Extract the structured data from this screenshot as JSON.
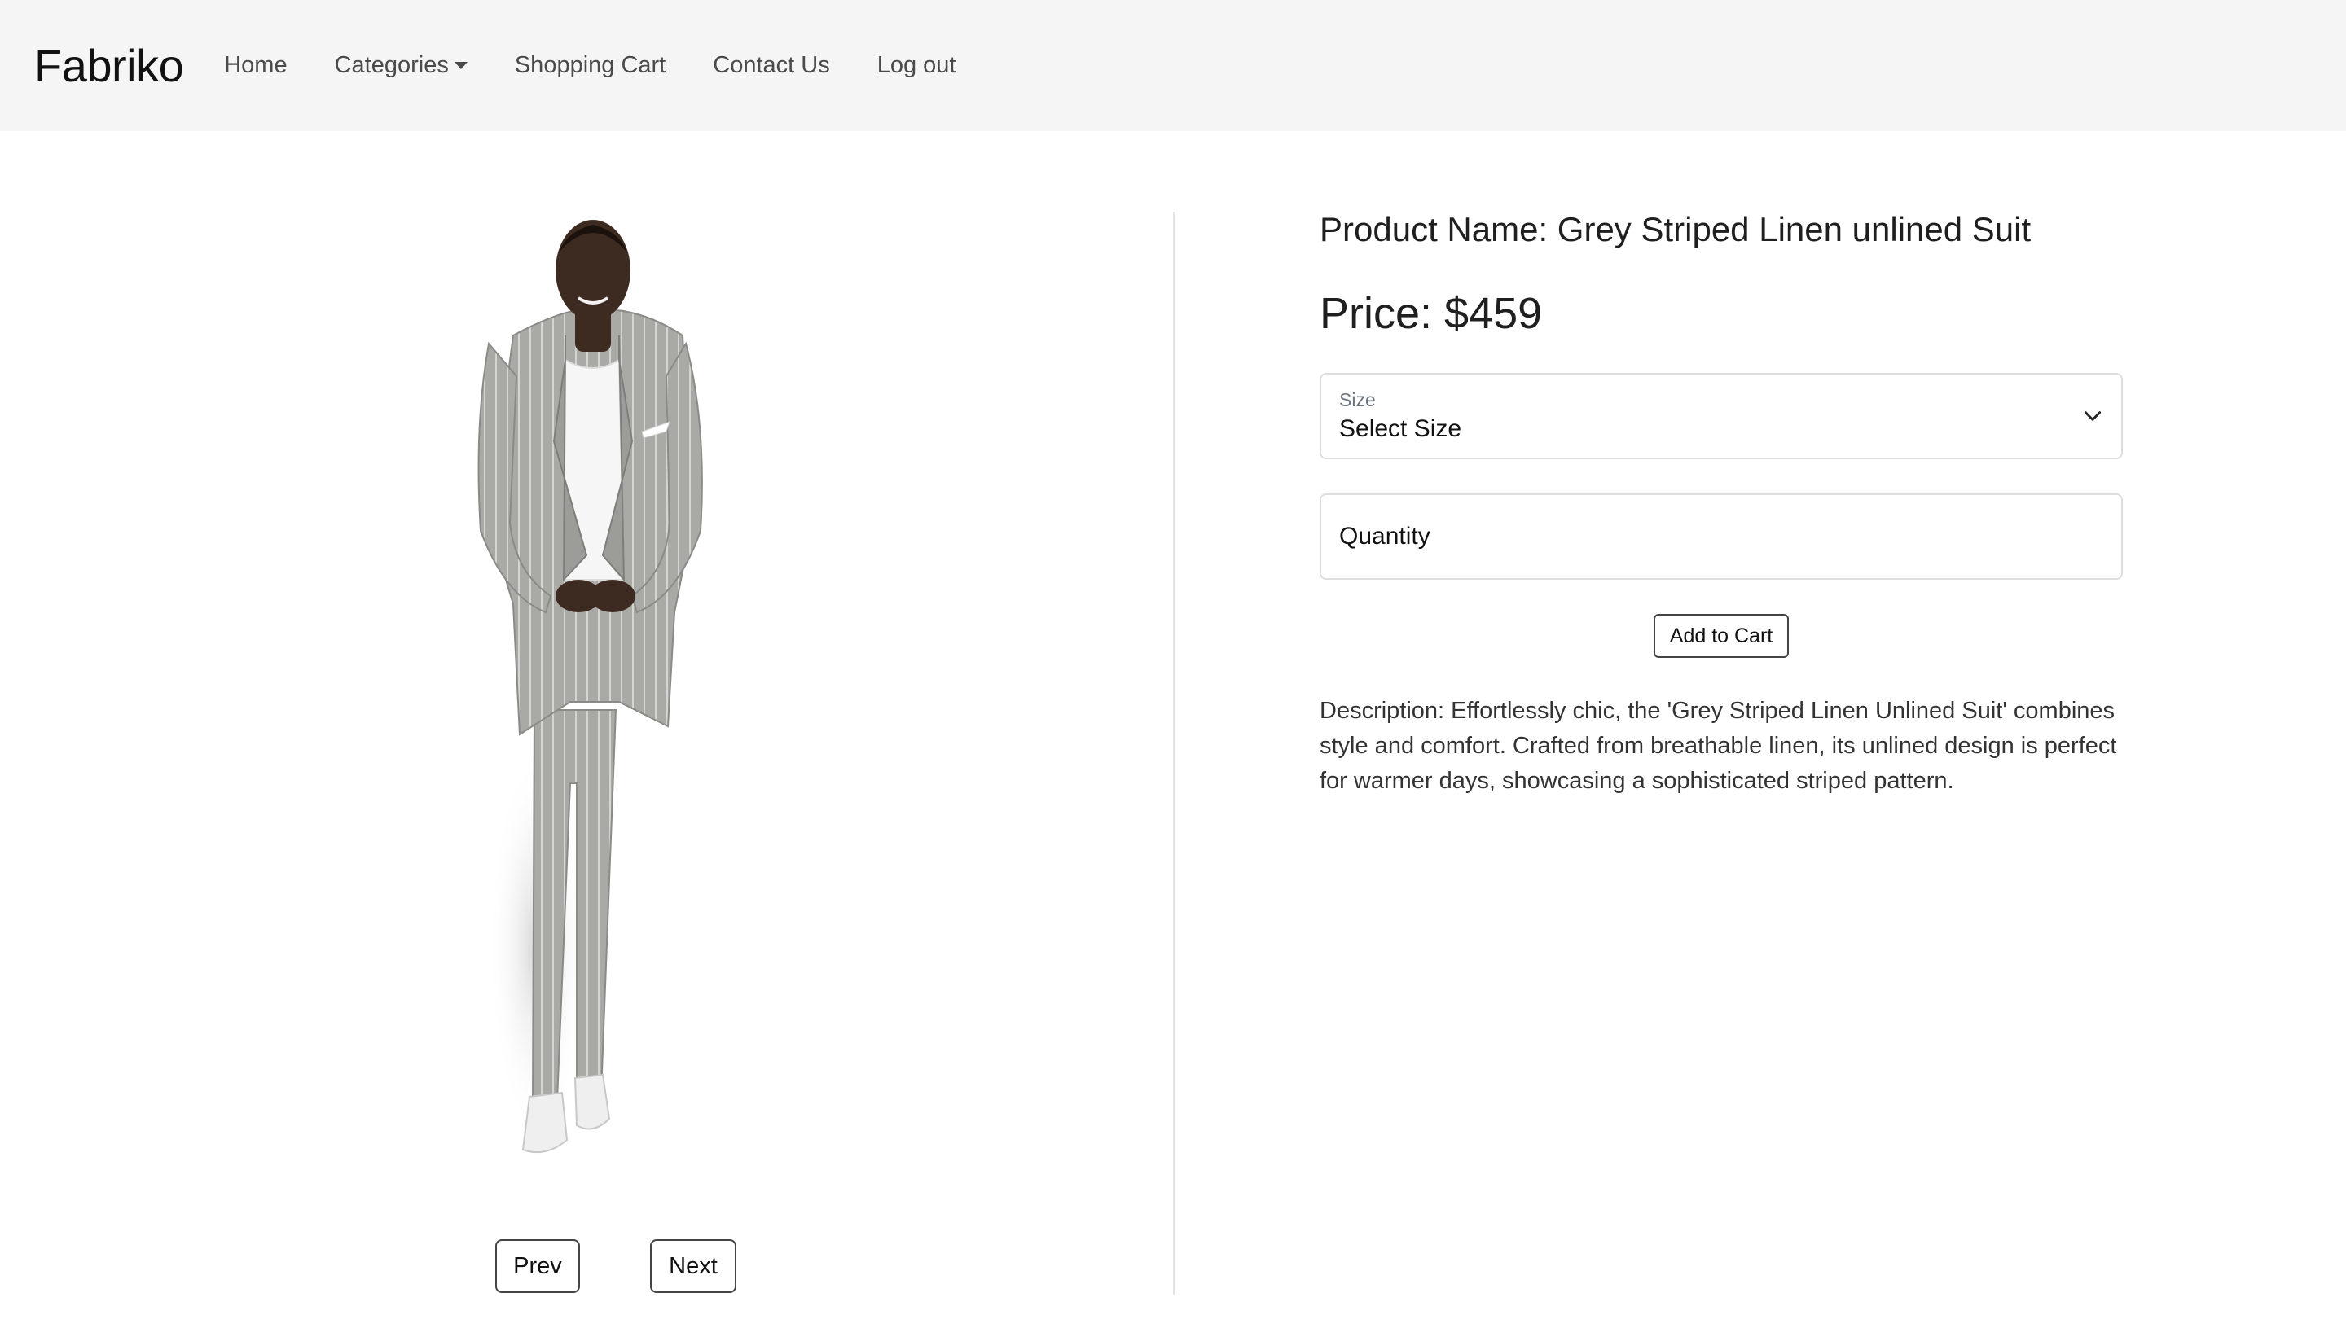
{
  "brand": "Fabriko",
  "nav": {
    "home": "Home",
    "categories": "Categories",
    "cart": "Shopping Cart",
    "contact": "Contact Us",
    "logout": "Log out"
  },
  "product": {
    "name": "Product Name: Grey Striped Linen unlined Suit",
    "price": "Price: $459",
    "description": "Description: Effortlessly chic, the 'Grey Striped Linen Unlined Suit' combines style and comfort. Crafted from breathable linen, its unlined design is perfect for warmer days, showcasing a sophisticated striped pattern."
  },
  "size_select": {
    "label": "Size",
    "selected": "Select Size"
  },
  "quantity": {
    "placeholder": "Quantity"
  },
  "buttons": {
    "add_to_cart": "Add to Cart",
    "prev": "Prev",
    "next": "Next"
  },
  "icons": {
    "chevron": "chevron-down-icon",
    "caret": "caret-down-icon"
  },
  "colors": {
    "navbar_bg": "#f5f5f5",
    "suit_grey": "#a9a9a6",
    "border": "#dedede"
  }
}
